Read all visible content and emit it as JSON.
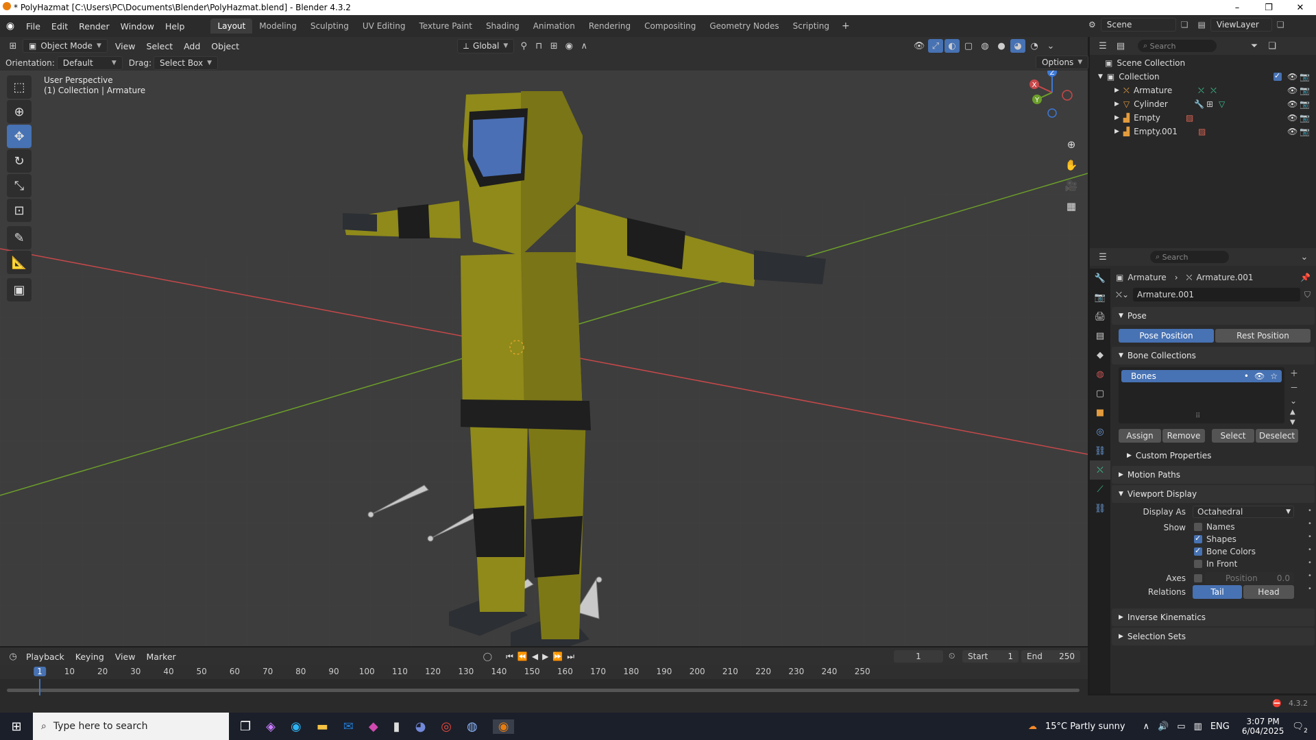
{
  "titlebar": {
    "title": "* PolyHazmat [C:\\Users\\PC\\Documents\\Blender\\PolyHazmat.blend] - Blender 4.3.2",
    "minimize": "–",
    "maximize": "❐",
    "close": "✕"
  },
  "menubar": {
    "menus": [
      "File",
      "Edit",
      "Render",
      "Window",
      "Help"
    ],
    "workspaces": [
      "Layout",
      "Modeling",
      "Sculpting",
      "UV Editing",
      "Texture Paint",
      "Shading",
      "Animation",
      "Rendering",
      "Compositing",
      "Geometry Nodes",
      "Scripting"
    ],
    "active_workspace": "Layout",
    "add_tab": "+",
    "scene": "Scene",
    "view_layer": "ViewLayer"
  },
  "viewport_header": {
    "mode": "Object Mode",
    "menus": [
      "View",
      "Select",
      "Add",
      "Object"
    ],
    "transform": "Global",
    "orientation_label": "Orientation:",
    "orientation": "Default",
    "drag_label": "Drag:",
    "drag": "Select Box",
    "options": "Options"
  },
  "viewport": {
    "perspective": "User Perspective",
    "collection_info": "(1) Collection | Armature",
    "gizmo_axes": [
      "X",
      "Y",
      "Z"
    ]
  },
  "outliner": {
    "search_placeholder": "Search",
    "scene_collection": "Scene Collection",
    "collection": "Collection",
    "items": [
      {
        "name": "Armature"
      },
      {
        "name": "Cylinder"
      },
      {
        "name": "Empty"
      },
      {
        "name": "Empty.001"
      }
    ]
  },
  "properties": {
    "search_placeholder": "Search",
    "breadcrumb_object": "Armature",
    "breadcrumb_data": "Armature.001",
    "data_name": "Armature.001",
    "pose": {
      "title": "Pose",
      "pose_position": "Pose Position",
      "rest_position": "Rest Position"
    },
    "bone_collections": {
      "title": "Bone Collections",
      "item": "Bones",
      "assign": "Assign",
      "remove": "Remove",
      "select": "Select",
      "deselect": "Deselect",
      "custom_properties": "Custom Properties"
    },
    "motion_paths": "Motion Paths",
    "viewport_display": {
      "title": "Viewport Display",
      "display_as_label": "Display As",
      "display_as": "Octahedral",
      "show_label": "Show",
      "names": "Names",
      "names_checked": false,
      "shapes": "Shapes",
      "shapes_checked": true,
      "bone_colors": "Bone Colors",
      "bone_colors_checked": true,
      "in_front": "In Front",
      "in_front_checked": false,
      "axes_label": "Axes",
      "position_label": "Position",
      "position_value": "0.0",
      "relations_label": "Relations",
      "tail": "Tail",
      "head": "Head"
    },
    "inverse_kinematics": "Inverse Kinematics",
    "selection_sets": "Selection Sets"
  },
  "timeline": {
    "menus": [
      "Playback",
      "Keying",
      "View",
      "Marker"
    ],
    "current_frame": "1",
    "start_label": "Start",
    "start": "1",
    "end_label": "End",
    "end": "250",
    "ruler": [
      "1",
      "10",
      "20",
      "30",
      "40",
      "50",
      "60",
      "70",
      "80",
      "90",
      "100",
      "110",
      "120",
      "130",
      "140",
      "150",
      "160",
      "170",
      "180",
      "190",
      "200",
      "210",
      "220",
      "230",
      "240",
      "250"
    ]
  },
  "statusbar": {
    "version": "4.3.2"
  },
  "taskbar": {
    "search_placeholder": "Type here to search",
    "weather": "15°C  Partly sunny",
    "language": "ENG",
    "time": "3:07 PM",
    "date": "6/04/2025",
    "notification_count": "2"
  },
  "colors": {
    "accent": "#4772b3",
    "suit": "#8f8a1a",
    "x_axis": "#c8484a",
    "y_axis": "#6c9f2a",
    "z_axis": "#3d79d6"
  }
}
